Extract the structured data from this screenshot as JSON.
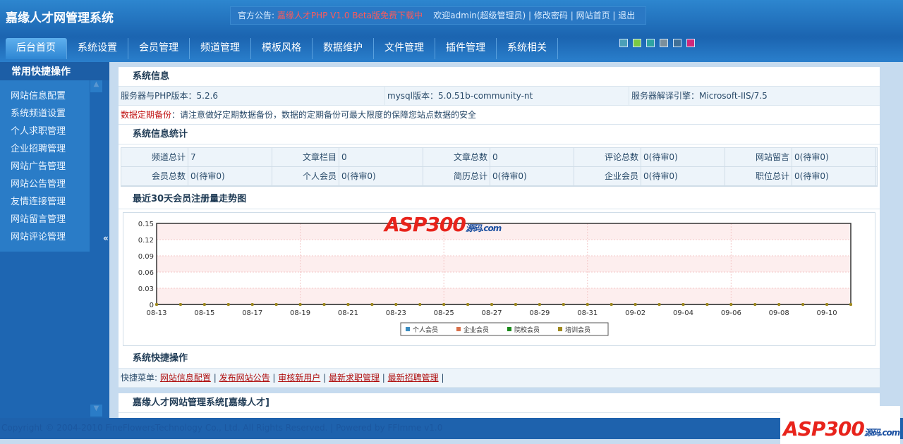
{
  "header": {
    "title": "嘉缘人才网管理系统",
    "notice_label": "官方公告:",
    "notice_text": "嘉缘人才PHP V1.0 Beta版免费下载中",
    "welcome": "欢迎admin(超级管理员)",
    "links": [
      "修改密码",
      "网站首页",
      "退出"
    ]
  },
  "nav": [
    "后台首页",
    "系统设置",
    "会员管理",
    "频道管理",
    "模板风格",
    "数据维护",
    "文件管理",
    "插件管理",
    "系统相关"
  ],
  "skins": [
    "#4a9fb8",
    "#7ac943",
    "#2ea3a3",
    "#7b8f9c",
    "#3f6f96",
    "#d0287a"
  ],
  "sidebar": {
    "title": "常用快捷操作",
    "items": [
      "网站信息配置",
      "系统频道设置",
      "个人求职管理",
      "企业招聘管理",
      "网站广告管理",
      "网站公告管理",
      "友情连接管理",
      "网站留言管理",
      "网站评论管理"
    ],
    "collapse": "«"
  },
  "sysinfo": {
    "title": "系统信息",
    "php": "服务器与PHP版本：5.2.6",
    "mysql": "mysql版本：5.0.51b-community-nt",
    "engine": "服务器解译引擎：Microsoft-IIS/7.5",
    "backup_label": "数据定期备份",
    "backup_text": "：请注意做好定期数据备份，数据的定期备份可最大限度的保障您站点数据的安全"
  },
  "stats": {
    "title": "系统信息统计",
    "rows": [
      [
        [
          "频道总计",
          "7"
        ],
        [
          "文章栏目",
          "0"
        ],
        [
          "文章总数",
          "0"
        ],
        [
          "评论总数",
          "0(待审0)"
        ],
        [
          "网站留言",
          "0(待审0)"
        ]
      ],
      [
        [
          "会员总数",
          "0(待审0)"
        ],
        [
          "个人会员",
          "0(待审0)"
        ],
        [
          "简历总计",
          "0(待审0)"
        ],
        [
          "企业会员",
          "0(待审0)"
        ],
        [
          "职位总计",
          "0(待审0)"
        ]
      ]
    ]
  },
  "chart_title": "最近30天会员注册量走势图",
  "chart_data": {
    "type": "line",
    "title": "最近30天会员注册量走势图",
    "x": [
      "08-13",
      "08-14",
      "08-15",
      "08-16",
      "08-17",
      "08-18",
      "08-19",
      "08-20",
      "08-21",
      "08-22",
      "08-23",
      "08-24",
      "08-25",
      "08-26",
      "08-27",
      "08-28",
      "08-29",
      "08-30",
      "08-31",
      "09-01",
      "09-02",
      "09-03",
      "09-04",
      "09-05",
      "09-06",
      "09-07",
      "09-08",
      "09-09",
      "09-10",
      "09-11"
    ],
    "xticks": [
      "08-13",
      "08-15",
      "08-17",
      "08-19",
      "08-21",
      "08-23",
      "08-25",
      "08-27",
      "08-29",
      "08-31",
      "09-02",
      "09-04",
      "09-06",
      "09-08",
      "09-10"
    ],
    "yticks": [
      "0",
      "0.03",
      "0.06",
      "0.09",
      "0.12",
      "0.15"
    ],
    "ylim": [
      0,
      0.15
    ],
    "series": [
      {
        "name": "个人会员",
        "color": "#3a8cc0",
        "values": [
          0,
          0,
          0,
          0,
          0,
          0,
          0,
          0,
          0,
          0,
          0,
          0,
          0,
          0,
          0,
          0,
          0,
          0,
          0,
          0,
          0,
          0,
          0,
          0,
          0,
          0,
          0,
          0,
          0,
          0
        ]
      },
      {
        "name": "企业会员",
        "color": "#d9704a",
        "values": [
          0,
          0,
          0,
          0,
          0,
          0,
          0,
          0,
          0,
          0,
          0,
          0,
          0,
          0,
          0,
          0,
          0,
          0,
          0,
          0,
          0,
          0,
          0,
          0,
          0,
          0,
          0,
          0,
          0,
          0
        ]
      },
      {
        "name": "院校会员",
        "color": "#1a8a1a",
        "values": [
          0,
          0,
          0,
          0,
          0,
          0,
          0,
          0,
          0,
          0,
          0,
          0,
          0,
          0,
          0,
          0,
          0,
          0,
          0,
          0,
          0,
          0,
          0,
          0,
          0,
          0,
          0,
          0,
          0,
          0
        ]
      },
      {
        "name": "培训会员",
        "color": "#a08a20",
        "values": [
          0,
          0,
          0,
          0,
          0,
          0,
          0,
          0,
          0,
          0,
          0,
          0,
          0,
          0,
          0,
          0,
          0,
          0,
          0,
          0,
          0,
          0,
          0,
          0,
          0,
          0,
          0,
          0,
          0,
          0
        ]
      }
    ],
    "legend": "bottom-center"
  },
  "quick": {
    "title": "系统快捷操作",
    "label": "快捷菜单:",
    "links": [
      "网站信息配置",
      "发布网站公告",
      "审核新用户",
      "最新求职管理",
      "最新招聘管理"
    ]
  },
  "bottom_title": "嘉缘人才网站管理系统[嘉缘人才]",
  "footer": "Copyright © 2004-2010 FineFlowersTechnology Co., Ltd. All Rights Reserved. | Powered by FFlmme v1.0",
  "watermark": "ASP300源码.com"
}
